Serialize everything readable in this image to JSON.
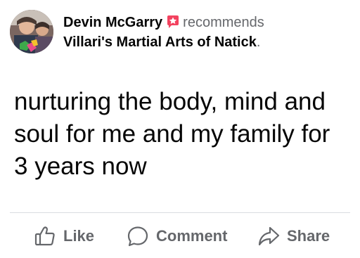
{
  "post": {
    "author": "Devin McGarry",
    "action_word": "recommends",
    "page_name": "Villari's Martial Arts of Natick",
    "page_suffix": ".",
    "body": "nurturing the body, mind and soul for me and my family for 3 years now"
  },
  "actions": {
    "like_label": "Like",
    "comment_label": "Comment",
    "share_label": "Share"
  },
  "icons": {
    "recommend_badge": "star-flag-icon",
    "like": "thumbs-up-icon",
    "comment": "speech-bubble-icon",
    "share": "share-arrow-icon"
  },
  "colors": {
    "text_primary": "#050505",
    "text_secondary": "#65676b",
    "recommend_badge": "#f3425f",
    "divider": "#dadde1"
  }
}
